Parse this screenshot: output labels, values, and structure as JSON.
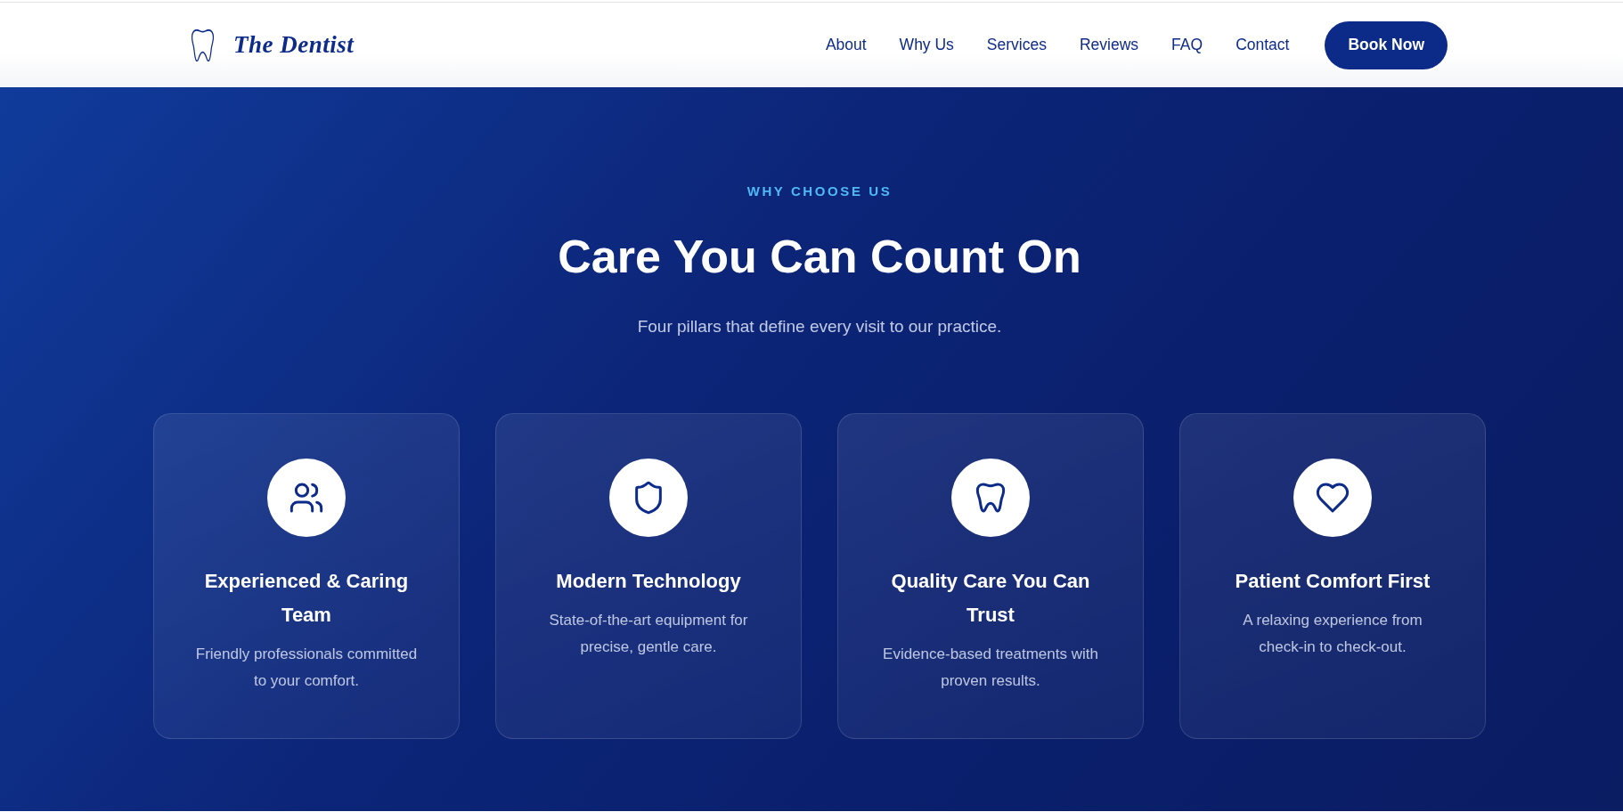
{
  "header": {
    "logo": {
      "text": "The Dentist"
    },
    "nav": [
      {
        "label": "About"
      },
      {
        "label": "Why Us"
      },
      {
        "label": "Services"
      },
      {
        "label": "Reviews"
      },
      {
        "label": "FAQ"
      },
      {
        "label": "Contact"
      }
    ],
    "cta": {
      "label": "Book Now"
    }
  },
  "section": {
    "eyebrow": "WHY CHOOSE US",
    "title": "Care You Can Count On",
    "subtitle": "Four pillars that define every visit to our practice.",
    "cards": [
      {
        "kind": "people",
        "title": "Experienced & Caring Team",
        "text": "Friendly professionals committed to your comfort."
      },
      {
        "kind": "shield",
        "title": "Modern Technology",
        "text": "State-of-the-art equipment for precise, gentle care."
      },
      {
        "kind": "tooth",
        "title": "Quality Care You Can Trust",
        "text": "Evidence-based treatments with proven results."
      },
      {
        "kind": "heart",
        "title": "Patient Comfort First",
        "text": "A relaxing experience from check-in to check-out."
      }
    ]
  }
}
